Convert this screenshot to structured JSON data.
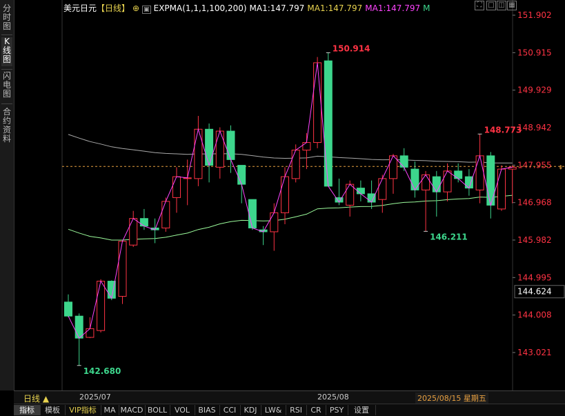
{
  "header": {
    "symbol": "美元日元",
    "period": "【日线】",
    "plus_icon": "add-circle-icon",
    "collapse_icon": "collapse-box-icon",
    "indicator": "EXPMA(1,1,1,100,200)",
    "ma1_a": "MA1:147.797",
    "ma1_b": "MA1:147.797",
    "ma1_c": "MA1:147.797",
    "m": "M"
  },
  "left_tabs": [
    "分时图",
    "K线图",
    "闪电图",
    "合约资料"
  ],
  "toolbar_icons": [
    "fullscreen-icon",
    "window-icon",
    "split-icon",
    "grid-icon"
  ],
  "chart_data": {
    "type": "candlestick",
    "title": "美元日元 日线",
    "price_axis_ticks": [
      "151.902",
      "150.915",
      "149.929",
      "148.942",
      "147.955",
      "146.968",
      "145.982",
      "144.995",
      "144.008",
      "143.021"
    ],
    "ylim": [
      142.6,
      152.0
    ],
    "current_price_label": "144.624",
    "reference_line": 147.92,
    "annotations": [
      {
        "text": "150.914",
        "value": 150.914,
        "kind": "high"
      },
      {
        "text": "148.773",
        "value": 148.773,
        "kind": "high"
      },
      {
        "text": "146.211",
        "value": 146.211,
        "kind": "low"
      },
      {
        "text": "142.680",
        "value": 142.68,
        "kind": "low"
      }
    ],
    "x_labels": [
      "2025/07",
      "2025/08"
    ],
    "colors": {
      "up": "#ff3344",
      "down": "#3dd68c",
      "ma_line": "#ff44ff",
      "ma_long": "#9cfc9c",
      "ma_vlong": "#aaaaaa"
    },
    "candles": [
      {
        "o": 144.35,
        "h": 144.55,
        "l": 143.95,
        "c": 143.98
      },
      {
        "o": 143.98,
        "h": 144.05,
        "l": 142.68,
        "c": 143.4
      },
      {
        "o": 143.42,
        "h": 143.95,
        "l": 143.4,
        "c": 143.65
      },
      {
        "o": 143.6,
        "h": 144.95,
        "l": 143.55,
        "c": 144.9
      },
      {
        "o": 144.9,
        "h": 144.92,
        "l": 144.4,
        "c": 144.45
      },
      {
        "o": 144.5,
        "h": 145.95,
        "l": 144.3,
        "c": 145.95
      },
      {
        "o": 145.85,
        "h": 146.75,
        "l": 145.8,
        "c": 146.55
      },
      {
        "o": 146.55,
        "h": 146.8,
        "l": 146.25,
        "c": 146.35
      },
      {
        "o": 146.3,
        "h": 146.55,
        "l": 145.9,
        "c": 146.25
      },
      {
        "o": 146.3,
        "h": 147.1,
        "l": 146.2,
        "c": 147.0
      },
      {
        "o": 147.1,
        "h": 147.9,
        "l": 146.7,
        "c": 147.65
      },
      {
        "o": 147.6,
        "h": 148.1,
        "l": 146.9,
        "c": 147.62
      },
      {
        "o": 147.6,
        "h": 149.25,
        "l": 147.4,
        "c": 148.9
      },
      {
        "o": 148.9,
        "h": 149.05,
        "l": 147.5,
        "c": 147.95
      },
      {
        "o": 147.9,
        "h": 148.95,
        "l": 147.6,
        "c": 148.85
      },
      {
        "o": 148.85,
        "h": 149.0,
        "l": 147.75,
        "c": 148.1
      },
      {
        "o": 147.95,
        "h": 147.95,
        "l": 146.95,
        "c": 147.45
      },
      {
        "o": 147.05,
        "h": 147.05,
        "l": 146.25,
        "c": 146.3
      },
      {
        "o": 146.25,
        "h": 146.35,
        "l": 145.85,
        "c": 146.2
      },
      {
        "o": 146.2,
        "h": 146.95,
        "l": 145.7,
        "c": 146.7
      },
      {
        "o": 146.7,
        "h": 147.9,
        "l": 146.4,
        "c": 147.65
      },
      {
        "o": 147.6,
        "h": 148.5,
        "l": 147.5,
        "c": 148.35
      },
      {
        "o": 148.35,
        "h": 148.8,
        "l": 147.85,
        "c": 148.55
      },
      {
        "o": 148.55,
        "h": 150.8,
        "l": 148.4,
        "c": 150.65
      },
      {
        "o": 150.7,
        "h": 150.914,
        "l": 147.4,
        "c": 147.4
      },
      {
        "o": 147.1,
        "h": 147.6,
        "l": 146.9,
        "c": 146.98
      },
      {
        "o": 146.9,
        "h": 147.55,
        "l": 146.6,
        "c": 147.45
      },
      {
        "o": 147.35,
        "h": 147.55,
        "l": 147.0,
        "c": 147.2
      },
      {
        "o": 147.2,
        "h": 147.55,
        "l": 146.8,
        "c": 146.98
      },
      {
        "o": 147.05,
        "h": 147.7,
        "l": 146.7,
        "c": 147.6
      },
      {
        "o": 147.6,
        "h": 148.25,
        "l": 147.2,
        "c": 148.2
      },
      {
        "o": 148.2,
        "h": 148.4,
        "l": 147.8,
        "c": 147.9
      },
      {
        "o": 147.85,
        "h": 148.05,
        "l": 147.1,
        "c": 147.3
      },
      {
        "o": 147.3,
        "h": 147.8,
        "l": 146.211,
        "c": 147.7
      },
      {
        "o": 147.65,
        "h": 147.8,
        "l": 146.6,
        "c": 147.25
      },
      {
        "o": 147.25,
        "h": 148.0,
        "l": 147.0,
        "c": 147.8
      },
      {
        "o": 147.8,
        "h": 148.0,
        "l": 147.5,
        "c": 147.6
      },
      {
        "o": 147.65,
        "h": 147.85,
        "l": 147.15,
        "c": 147.35
      },
      {
        "o": 147.3,
        "h": 148.773,
        "l": 146.95,
        "c": 148.2
      },
      {
        "o": 148.2,
        "h": 148.3,
        "l": 146.55,
        "c": 146.9
      },
      {
        "o": 146.8,
        "h": 147.95,
        "l": 146.75,
        "c": 147.85
      },
      {
        "o": 147.85,
        "h": 147.95,
        "l": 146.95,
        "c": 147.9
      }
    ]
  },
  "bottom": {
    "timeframe": "日线",
    "date_jul": "2025/07",
    "date_aug": "2025/08",
    "current_date": "2025/08/15 星期五",
    "indicators": [
      "指标",
      "模板",
      "VIP指标",
      "MA",
      "MACD",
      "BOLL",
      "VOL",
      "BIAS",
      "CCI",
      "KDJ",
      "LW&",
      "RSI",
      "CR",
      "PSY",
      "设置"
    ]
  }
}
